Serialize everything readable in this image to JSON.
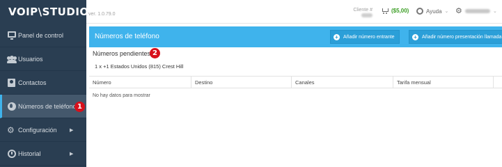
{
  "header": {
    "logo": "VOIP\\STUDIO",
    "version": "ver. 1.0.79.0",
    "client_label": "Cliente #",
    "balance": "($5,00)",
    "help_label": "Ayuda"
  },
  "sidebar": {
    "items": [
      {
        "label": "Panel de control",
        "icon": "monitor-icon"
      },
      {
        "label": "Usuarios",
        "icon": "users-icon"
      },
      {
        "label": "Contactos",
        "icon": "contacts-icon"
      },
      {
        "label": "Números de teléfono",
        "icon": "globe-icon",
        "active": true
      },
      {
        "label": "Configuración",
        "icon": "gears-icon"
      },
      {
        "label": "Historial",
        "icon": "clock-icon"
      }
    ]
  },
  "main": {
    "title": "Números de teléfono",
    "btn_inbound": "Añadir número entrante",
    "btn_presentation": "Añadir número presentación llamada",
    "pending_title": "Números pendientes",
    "pending_item": "1 x +1 Estados Unidos (815) Crest Hill",
    "columns": [
      "Número",
      "Destino",
      "Canales",
      "Tarifa mensual"
    ],
    "empty_text": "No hay datos para mostrar"
  },
  "annotations": {
    "badge1": "1",
    "badge2": "2"
  },
  "colors": {
    "sidebar": "#2a3e52",
    "accent": "#3fb3ec",
    "badge": "#d8101b",
    "balance": "#3a9d23"
  }
}
